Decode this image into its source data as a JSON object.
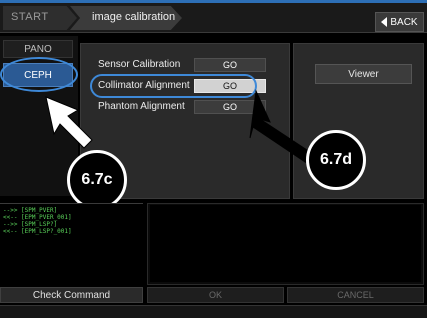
{
  "header": {
    "start_label": "START",
    "title": "image calibration",
    "back_label": "BACK"
  },
  "sidebar": {
    "items": [
      {
        "label": "PANO",
        "active": false
      },
      {
        "label": "CEPH",
        "active": true
      }
    ]
  },
  "calibration": {
    "rows": [
      {
        "label": "Sensor Calibration",
        "button": "GO",
        "highlighted": false
      },
      {
        "label": "Collimator Alignment",
        "button": "GO",
        "highlighted": true
      },
      {
        "label": "Phantom Alignment",
        "button": "GO",
        "highlighted": false
      }
    ]
  },
  "viewer": {
    "label": "Viewer"
  },
  "annotations": {
    "callout_c": "6.7c",
    "callout_d": "6.7d"
  },
  "log": {
    "lines": [
      "-->> [SPM_PVER]",
      "<<-- [EPM_PVER_001]",
      "-->> [SPM_LSP?]",
      "<<-- [EPM_LSP?_001]"
    ]
  },
  "footer": {
    "check_command": "Check Command",
    "ok": "OK",
    "cancel": "CANCEL"
  },
  "colors": {
    "accent_blue": "#2b5a94",
    "highlight_ring": "#3e89d8",
    "log_text": "#5ad15a"
  }
}
